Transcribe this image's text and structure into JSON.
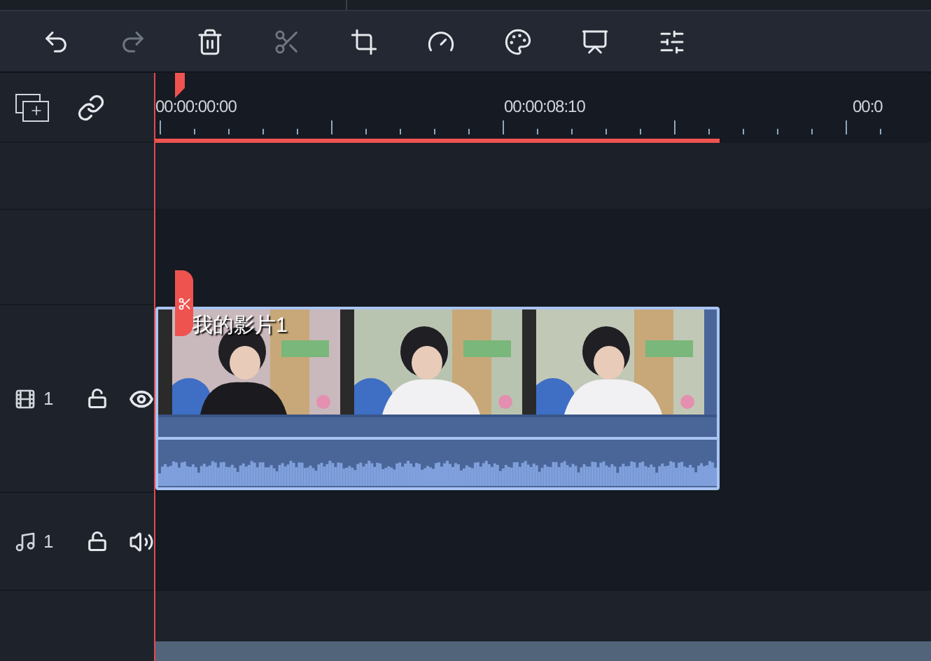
{
  "toolbar": [
    {
      "kind": "undo",
      "disabled": false
    },
    {
      "kind": "redo",
      "disabled": true
    },
    {
      "kind": "delete",
      "disabled": false
    },
    {
      "kind": "cut",
      "disabled": true
    },
    {
      "kind": "crop",
      "disabled": false
    },
    {
      "kind": "speed",
      "disabled": false
    },
    {
      "kind": "color",
      "disabled": false
    },
    {
      "kind": "presenter",
      "disabled": false
    },
    {
      "kind": "adjust",
      "disabled": false
    }
  ],
  "ruler": {
    "timecodes": [
      "00:00:00:00",
      "00:00:08:10",
      "00:0"
    ]
  },
  "tracks": [
    {
      "kind": "video",
      "number": "1",
      "locked": false,
      "visible": true,
      "clip": {
        "title": "我的影片1"
      }
    },
    {
      "kind": "audio",
      "number": "1",
      "locked": false,
      "muted": false
    }
  ]
}
